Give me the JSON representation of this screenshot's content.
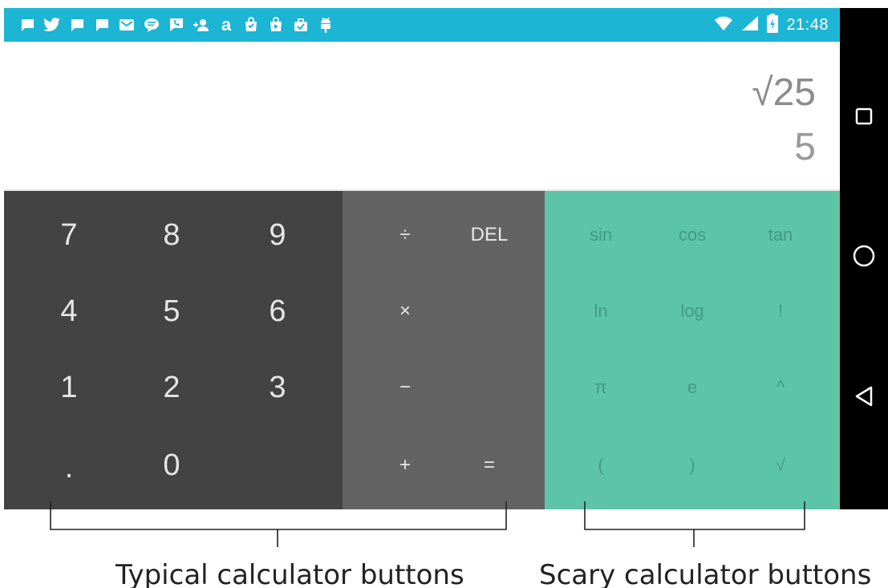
{
  "status_bar": {
    "time": "21:48",
    "notification_icons": [
      "message-icon",
      "twitter-icon",
      "message-icon",
      "message-icon",
      "mail-icon",
      "chat-icon",
      "phone-icon",
      "person-add-icon",
      "amazon-icon",
      "shopping-bag-icon",
      "store-icon",
      "briefcase-icon",
      "android-icon"
    ],
    "colors": {
      "background": "#1cb5d4"
    }
  },
  "display": {
    "expression": "√25",
    "result": "5"
  },
  "keypad": {
    "numbers": [
      "7",
      "8",
      "9",
      "4",
      "5",
      "6",
      "1",
      "2",
      "3",
      ".",
      "0"
    ],
    "operators": [
      "÷",
      "DEL",
      "×",
      "−",
      "+",
      "="
    ],
    "advanced": [
      "sin",
      "cos",
      "tan",
      "ln",
      "log",
      "!",
      "π",
      "e",
      "^",
      "(",
      ")",
      "√"
    ]
  },
  "nav_bar": {
    "buttons": [
      "recent-apps",
      "home",
      "back"
    ]
  },
  "callouts": {
    "typical": "Typical calculator buttons",
    "scary": "Scary calculator buttons"
  },
  "colors": {
    "pad": "#434343",
    "operators": "#636363",
    "advanced": "#5ec4a7"
  }
}
